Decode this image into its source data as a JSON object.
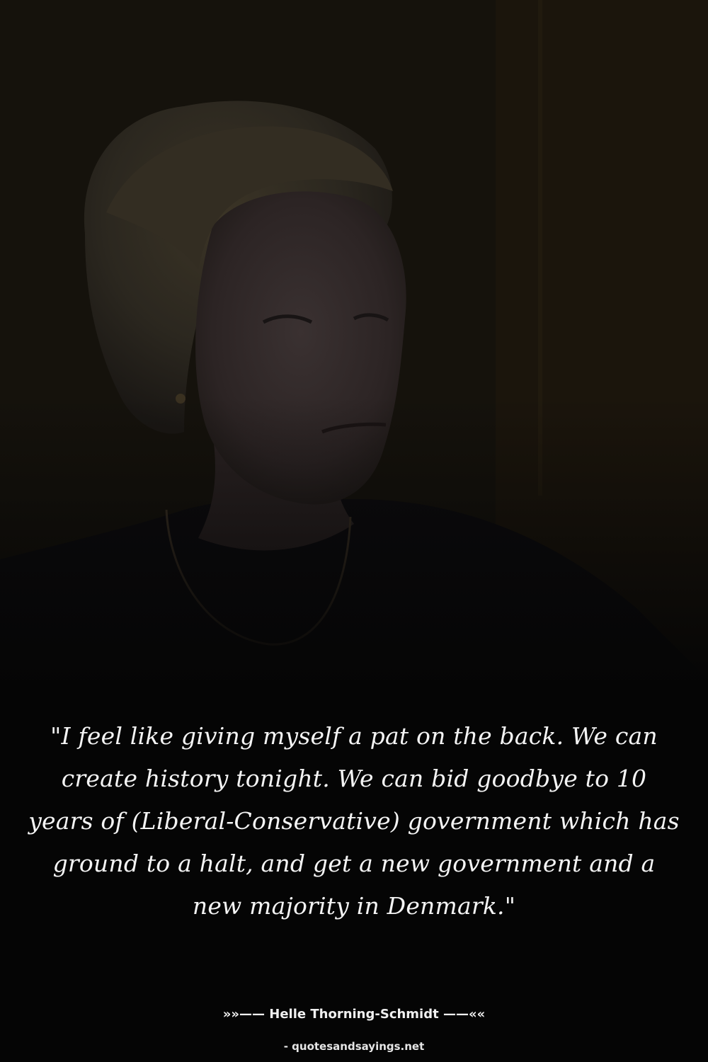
{
  "image": {
    "subject": "woman-portrait",
    "background_color": "#1a150d"
  },
  "quote": {
    "text": "\"I feel like giving myself a pat on the back. We can create history tonight. We can bid goodbye to 10 years of (Liberal-Conservative) government which has ground to a halt, and get a new government and a new majority in Denmark.\""
  },
  "author": {
    "line": "»»—— Helle Thorning-Schmidt ——««"
  },
  "source": {
    "line": "- quotesandsayings.net"
  }
}
